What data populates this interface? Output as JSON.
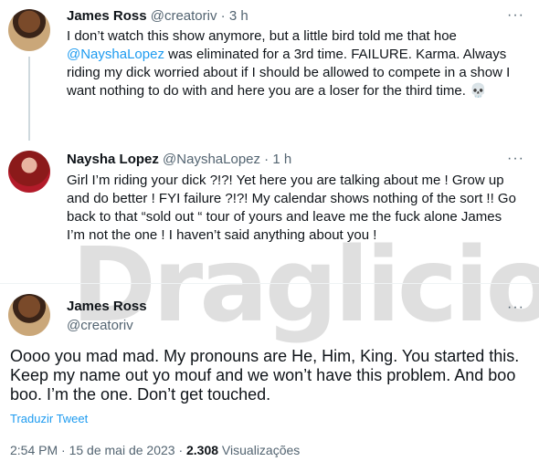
{
  "tweets": [
    {
      "name": "James Ross",
      "handle": "@creatoriv",
      "time": "3 h",
      "body_pre": "I don’t watch this show anymore, but a little bird told me that hoe",
      "mention": "@NayshaLopez",
      "body_post": " was eliminated for a 3rd time. FAILURE. Karma. Always riding my dick worried about if I should be allowed to compete in a show I want nothing to do with and here you are a loser for the third time. 💀"
    },
    {
      "name": "Naysha Lopez",
      "handle": "@NayshaLopez",
      "time": "1 h",
      "body": "Girl I’m riding your dick ?!?! Yet here you are talking about me ! Grow up and do better ! FYI failure ?!?! My calendar shows nothing of the sort !! Go back to that “sold out “ tour of yours and leave me the fuck alone James I’m not the one ! I haven’t said anything about you !"
    }
  ],
  "main_tweet": {
    "name": "James Ross",
    "handle": "@creatoriv",
    "body": "Oooo you mad mad. My pronouns are He, Him, King. You started this. Keep my name out yo mouf and we won’t have this problem. And boo boo. I’m the one. Don’t get touched.",
    "translate": "Traduzir Tweet",
    "timestamp": "2:54 PM · 15 de mai de 2023 · ",
    "views_count": "2.308",
    "views_label": " Visualizações"
  },
  "watermark": "Draglicious",
  "separator": " · ",
  "more_icon": "···"
}
